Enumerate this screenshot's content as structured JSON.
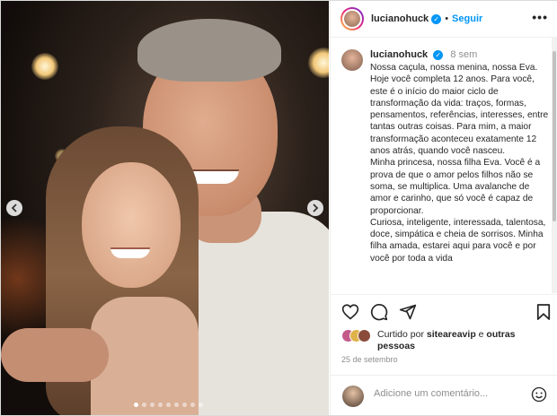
{
  "post": {
    "photo": {
      "carousel_dots": 9,
      "active_dot": 0,
      "prev_icon": "chevron-left-icon",
      "next_icon": "chevron-right-icon"
    },
    "header": {
      "username": "lucianohuck",
      "separator": "•",
      "follow_label": "Seguir",
      "more_label": "•••"
    },
    "caption": {
      "username": "lucianohuck",
      "time": "8 sem",
      "text": "Nossa caçula, nossa menina, nossa Eva. Hoje você completa 12 anos. Para você, este é o início do maior ciclo de transformação da vida: traços, formas, pensamentos, referências, interesses, entre tantas outras coisas. Para mim, a maior transformação aconteceu exatamente 12 anos atrás, quando você nasceu.\nMinha princesa, nossa filha Eva. Você é a prova de que o amor pelos filhos não se soma, se multiplica. Uma avalanche de amor e carinho, que só você é capaz de proporcionar.\nCuriosa, inteligente, interessada, talentosa, doce, simpática e cheia de sorrisos. Minha filha amada, estarei aqui para você e por você por toda a vida"
    },
    "likes": {
      "prefix": "Curtido por ",
      "user": "siteareavip",
      "middle": " e ",
      "others": "outras pessoas"
    },
    "date": "25 de setembro",
    "comment": {
      "placeholder": "Adicione um comentário..."
    },
    "colors": {
      "accent": "#0095f6",
      "text": "#262626",
      "muted": "#8e8e8e"
    }
  }
}
